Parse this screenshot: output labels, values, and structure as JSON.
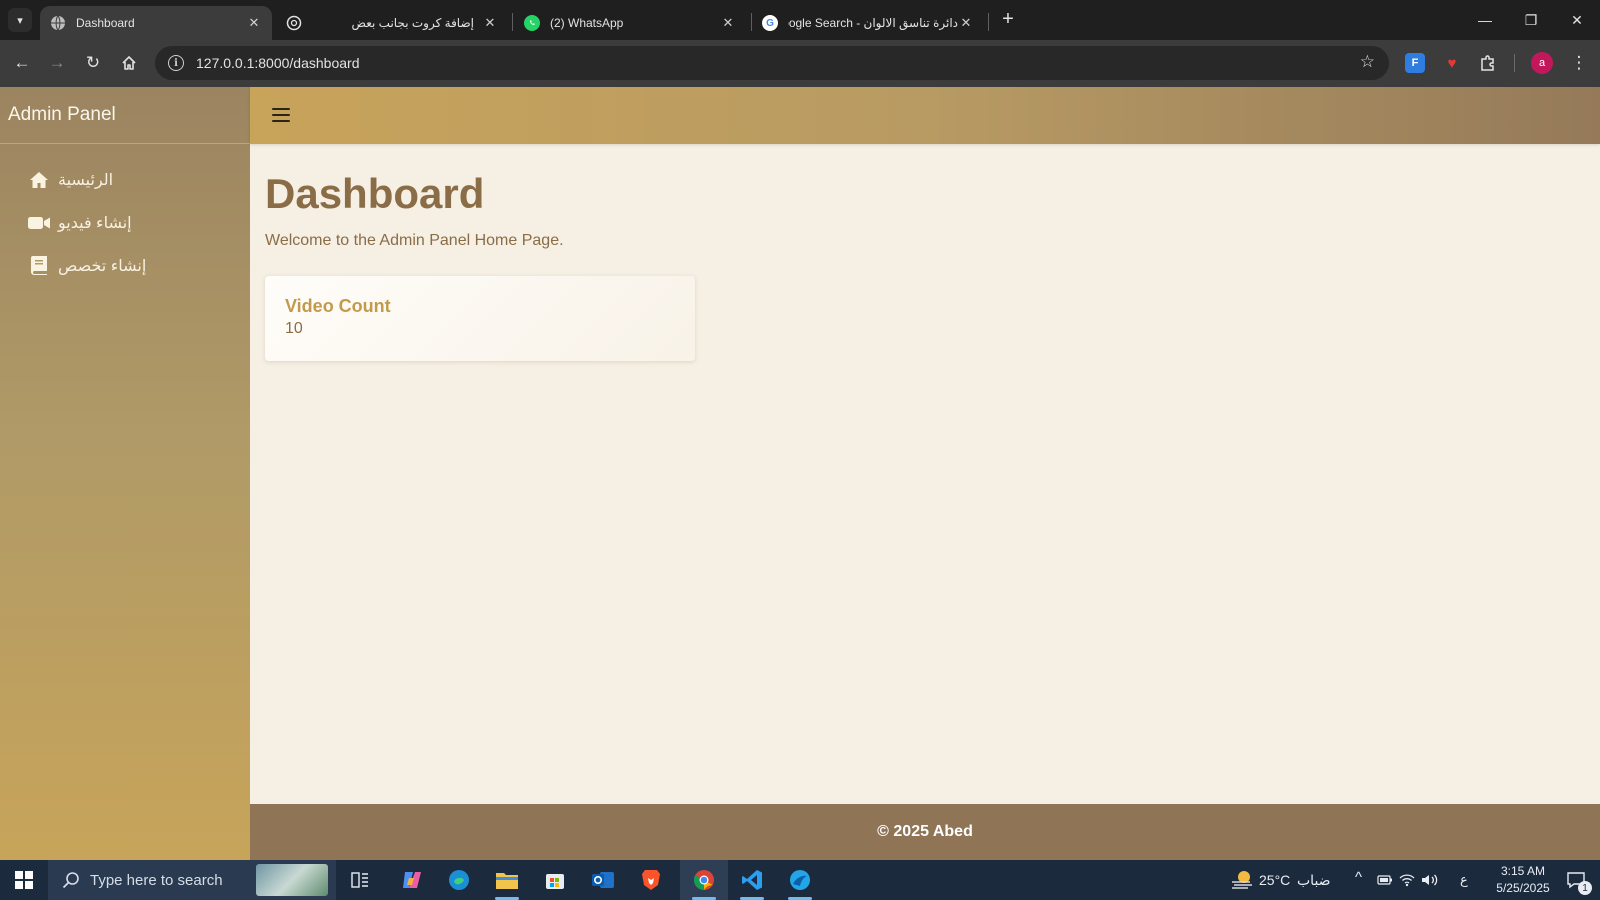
{
  "browser": {
    "tabs": [
      {
        "title": "Dashboard",
        "active": true,
        "icon": "globe-icon"
      },
      {
        "title": "إضافة كروت بجانب بعض",
        "active": false,
        "icon": "openai-icon"
      },
      {
        "title": "(2) WhatsApp",
        "active": false,
        "icon": "whatsapp-icon"
      },
      {
        "title": "دائرة تناسق الالوان - Google Search",
        "active": false,
        "icon": "google-icon"
      }
    ],
    "url": "127.0.0.1:8000/dashboard",
    "profile_initial": "a",
    "accent_color": "#3c3c3c"
  },
  "sidebar": {
    "brand": "Admin Panel",
    "items": [
      {
        "label": "الرئيسية",
        "icon": "home-icon"
      },
      {
        "label": "إنشاء فيديو",
        "icon": "video-camera-icon"
      },
      {
        "label": "إنشاء تخصص",
        "icon": "book-icon"
      }
    ]
  },
  "main": {
    "title": "Dashboard",
    "welcome": "Welcome to the Admin Panel Home Page.",
    "cards": [
      {
        "title": "Video Count",
        "value": "10"
      }
    ]
  },
  "footer": {
    "text": "© 2025 Abed"
  },
  "taskbar": {
    "search_placeholder": "Type here to search",
    "weather_temp": "25°C",
    "weather_desc": "ضباب",
    "input_lang": "ع",
    "time": "3:15 AM",
    "date": "5/25/2025",
    "notification_count": "1"
  },
  "colors": {
    "sidebar_top": "#9b8460",
    "sidebar_bottom": "#c7a45a",
    "topbar_left": "#c8a35a",
    "topbar_right": "#957a5a",
    "page_bg": "#f5efe4",
    "heading": "#8a6d47",
    "card_title": "#c39a4c",
    "footer_bg": "#8f7555"
  }
}
